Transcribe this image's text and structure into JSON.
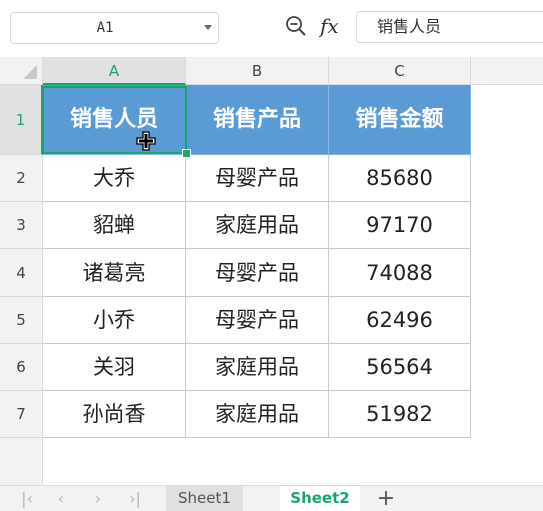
{
  "formula_bar": {
    "name_box": "A1",
    "fx_label": "fx",
    "formula_value": "销售人员"
  },
  "columns": [
    "A",
    "B",
    "C"
  ],
  "rows": [
    "1",
    "2",
    "3",
    "4",
    "5",
    "6",
    "7"
  ],
  "table": {
    "header": [
      "销售人员",
      "销售产品",
      "销售金额"
    ],
    "body": [
      [
        "大乔",
        "母婴产品",
        "85680"
      ],
      [
        "貂蝉",
        "家庭用品",
        "97170"
      ],
      [
        "诸葛亮",
        "母婴产品",
        "74088"
      ],
      [
        "小乔",
        "母婴产品",
        "62496"
      ],
      [
        "关羽",
        "家庭用品",
        "56564"
      ],
      [
        "孙尚香",
        "家庭用品",
        "51982"
      ]
    ]
  },
  "sheets": {
    "tab1": "Sheet1",
    "tab2": "Sheet2",
    "active": "Sheet2"
  },
  "colors": {
    "accent": "#1aa36c",
    "header_fill": "#5b9bd5",
    "header_text": "#ffffff"
  },
  "icons": {
    "nav_first": "first-sheet-icon",
    "nav_prev": "prev-sheet-icon",
    "nav_next": "next-sheet-icon",
    "nav_last": "last-sheet-icon",
    "add": "add-sheet-icon",
    "zoom": "zoom-icon",
    "cursor": "move-cursor-icon"
  }
}
